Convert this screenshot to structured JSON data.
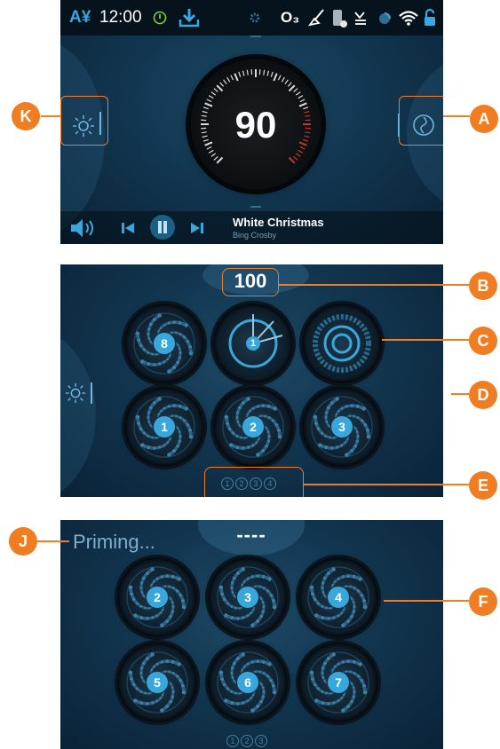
{
  "panel1": {
    "status": {
      "keyboard_label": "A¥",
      "clock": "12:00",
      "icons": [
        "power-icon",
        "download-icon",
        "gear-icon",
        "ozone-icon",
        "clean-icon",
        "filter-icon",
        "heat-icon",
        "jet-icon",
        "wifi-icon",
        "unlock-icon"
      ],
      "ozone_label": "O₃"
    },
    "speed_value": "90",
    "song_title": "White Christmas",
    "song_artist": "Bing Crosby"
  },
  "panel2": {
    "top_value": "100",
    "buttons": [
      {
        "num": "8"
      },
      {
        "num": "1"
      },
      {
        "num": ""
      },
      {
        "num": "1"
      },
      {
        "num": "2"
      },
      {
        "num": "3"
      }
    ],
    "page_dots": [
      "1",
      "2",
      "3",
      "4"
    ]
  },
  "panel3": {
    "status_text": "Priming...",
    "top_value": "----",
    "buttons": [
      {
        "num": "2"
      },
      {
        "num": "3"
      },
      {
        "num": "4"
      },
      {
        "num": "5"
      },
      {
        "num": "6"
      },
      {
        "num": "7"
      }
    ],
    "page_dots": [
      "1",
      "2",
      "3"
    ]
  },
  "callouts": {
    "A": "A",
    "B": "B",
    "C": "C",
    "D": "D",
    "E": "E",
    "F": "F",
    "J": "J",
    "K": "K"
  },
  "colors": {
    "accent": "#f07d21",
    "fan_blue": "#3aa7dc",
    "bg_dark": "#0a2236"
  }
}
